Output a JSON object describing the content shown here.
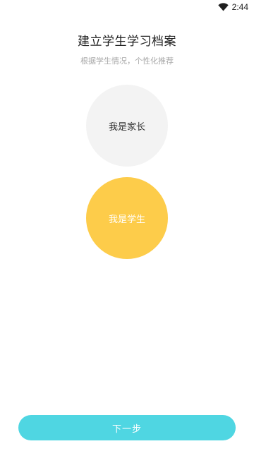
{
  "status_bar": {
    "time": "2:44",
    "wifi_icon": "wifi-icon"
  },
  "header": {
    "title": "建立学生学习档案",
    "subtitle": "根据学生情况，个性化推荐"
  },
  "roles": {
    "parent_label": "我是家长",
    "student_label": "我是学生",
    "selected": "student"
  },
  "footer": {
    "next_label": "下一步"
  },
  "colors": {
    "accent": "#4fd6e2",
    "selected_circle": "#fdcc4a",
    "unselected_circle": "#f3f3f3"
  }
}
